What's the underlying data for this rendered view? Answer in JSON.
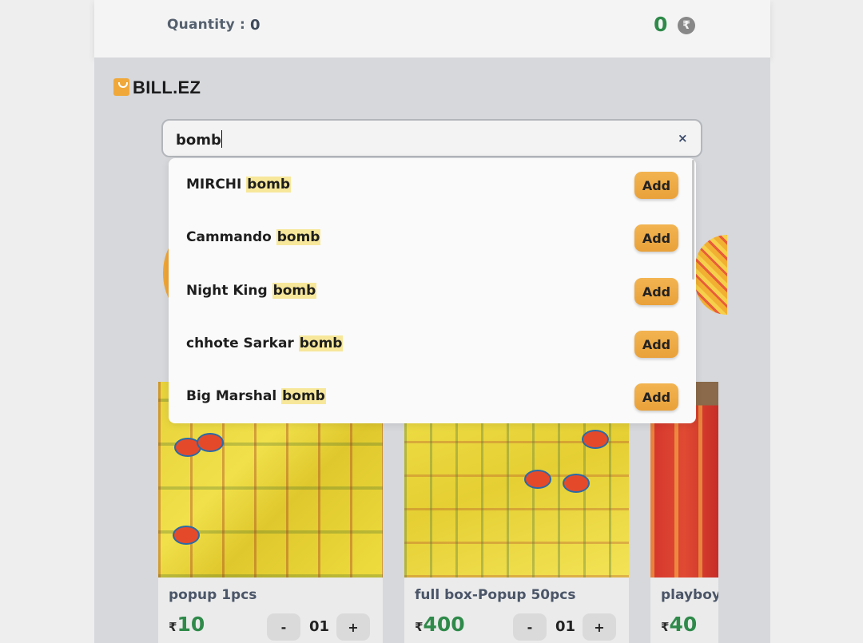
{
  "header": {
    "quantity_label": "Quantity :",
    "quantity_value": "0",
    "total_value": "0",
    "currency_icon": "rupee-icon",
    "currency_symbol": "₹"
  },
  "brand": {
    "name": "BILL.EZ",
    "icon": "shopping-bag-icon"
  },
  "search": {
    "value": "bomb",
    "clear_icon": "×"
  },
  "suggestions": [
    {
      "prefix": "MIRCHI ",
      "match": "bomb",
      "action": "Add"
    },
    {
      "prefix": "Cammando ",
      "match": "bomb",
      "action": "Add"
    },
    {
      "prefix": "Night King ",
      "match": "bomb",
      "action": "Add"
    },
    {
      "prefix": "chhote Sarkar ",
      "match": "bomb",
      "action": "Add"
    },
    {
      "prefix": "Big Marshal ",
      "match": "bomb",
      "action": "Add"
    }
  ],
  "products": [
    {
      "name": "popup 1pcs",
      "currency": "₹",
      "price": "10",
      "qty": "01",
      "minus": "-",
      "plus": "+"
    },
    {
      "name": "full box-Popup 50pcs",
      "currency": "₹",
      "price": "400",
      "qty": "01",
      "minus": "-",
      "plus": "+"
    },
    {
      "name": "playboy",
      "currency": "₹",
      "price": "40"
    }
  ],
  "colors": {
    "accent": "#f0a83a",
    "price_green": "#2f8a4a",
    "highlight": "#f7e79a"
  }
}
